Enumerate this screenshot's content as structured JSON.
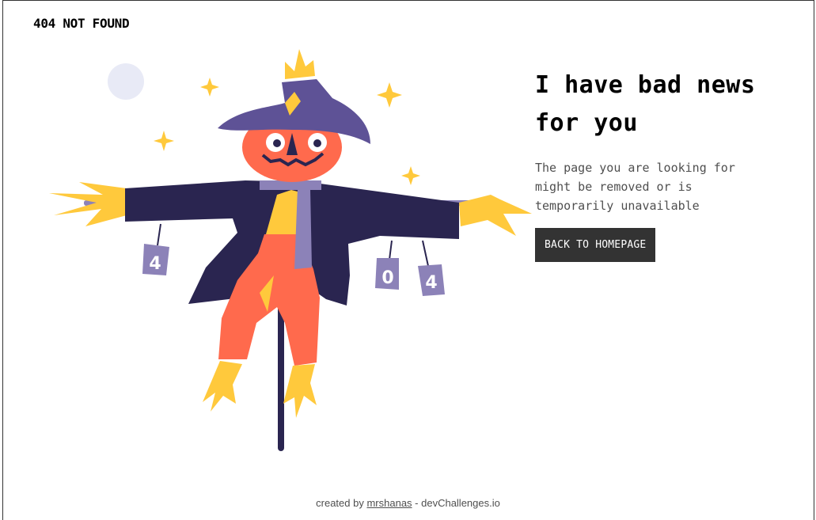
{
  "header": {
    "brand": "404 NOT FOUND"
  },
  "main": {
    "headline_line1": "I have bad news",
    "headline_line2": "for you",
    "message": "The page you are looking for might be removed or is temporarily unavailable",
    "button_label": "BACK TO HOMEPAGE"
  },
  "illustration": {
    "can_labels": [
      "4",
      "0",
      "4"
    ],
    "colors": {
      "hat": "#5e5296",
      "coat": "#2a2550",
      "pumpkin": "#ff6a4d",
      "straw": "#ffc93c",
      "can": "#8c82b8",
      "pole": "#2a2550",
      "moon": "#e8eaf6"
    }
  },
  "footer": {
    "prefix": "created by",
    "author": "mrshanas",
    "suffix": "- devChallenges.io"
  }
}
